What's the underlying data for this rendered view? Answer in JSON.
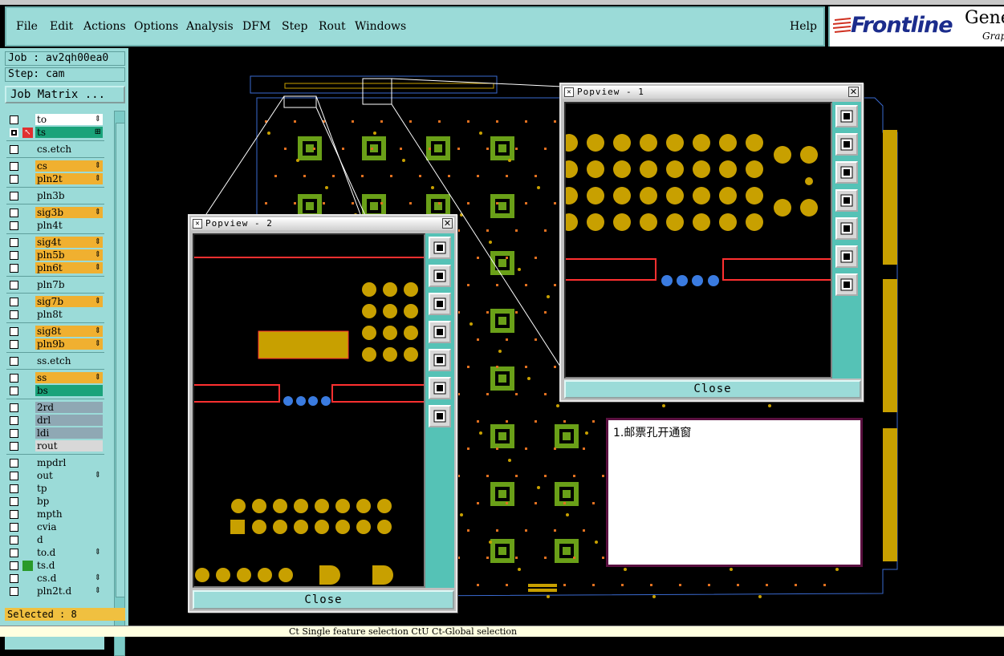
{
  "menu": {
    "items": [
      "File",
      "Edit",
      "Actions",
      "Options",
      "Analysis",
      "DFM",
      "Step",
      "Rout",
      "Windows"
    ],
    "help": "Help"
  },
  "brand": {
    "name": "Frontline",
    "sub1": "Gene",
    "sub2": "Grap"
  },
  "job": {
    "job_label": "Job : av2qh00ea0",
    "step_label": "Step: cam",
    "matrix_button": "Job Matrix ..."
  },
  "layers": [
    {
      "name": "to",
      "color": "#ffffff",
      "mark": "⇕"
    },
    {
      "name": "ts",
      "color": "#1aa37a",
      "mark": "⊞"
    },
    {
      "name": "cs.etch",
      "color": "#9bdbd8",
      "mark": ""
    },
    {
      "name": "cs",
      "color": "#f0b030",
      "mark": "⇕"
    },
    {
      "name": "pln2t",
      "color": "#f0b030",
      "mark": "⇕"
    },
    {
      "name": "pln3b",
      "color": "#9bdbd8",
      "mark": ""
    },
    {
      "name": "sig3b",
      "color": "#f0b030",
      "mark": "⇕"
    },
    {
      "name": "pln4t",
      "color": "#9bdbd8",
      "mark": ""
    },
    {
      "name": "sig4t",
      "color": "#f0b030",
      "mark": "⇕"
    },
    {
      "name": "pln5b",
      "color": "#f0b030",
      "mark": "⇕"
    },
    {
      "name": "pln6t",
      "color": "#f0b030",
      "mark": "⇕"
    },
    {
      "name": "pln7b",
      "color": "#9bdbd8",
      "mark": ""
    },
    {
      "name": "sig7b",
      "color": "#f0b030",
      "mark": "⇕"
    },
    {
      "name": "pln8t",
      "color": "#9bdbd8",
      "mark": ""
    },
    {
      "name": "sig8t",
      "color": "#f0b030",
      "mark": "⇕"
    },
    {
      "name": "pln9b",
      "color": "#f0b030",
      "mark": "⇕"
    },
    {
      "name": "ss.etch",
      "color": "#9bdbd8",
      "mark": ""
    },
    {
      "name": "ss",
      "color": "#f0b030",
      "mark": "⇕"
    },
    {
      "name": "bs",
      "color": "#1aa37a",
      "mark": ""
    },
    {
      "name": "2rd",
      "color": "#8fa8b4",
      "mark": ""
    },
    {
      "name": "drl",
      "color": "#8fa8b4",
      "mark": ""
    },
    {
      "name": "ldi",
      "color": "#8fa8b4",
      "mark": ""
    },
    {
      "name": "rout",
      "color": "#d8d8d8",
      "mark": ""
    },
    {
      "name": "mpdrl",
      "color": "#9bdbd8",
      "mark": ""
    },
    {
      "name": "out",
      "color": "#9bdbd8",
      "mark": "⇕"
    },
    {
      "name": "tp",
      "color": "#9bdbd8",
      "mark": ""
    },
    {
      "name": "bp",
      "color": "#9bdbd8",
      "mark": ""
    },
    {
      "name": "mpth",
      "color": "#9bdbd8",
      "mark": ""
    },
    {
      "name": "cvia",
      "color": "#9bdbd8",
      "mark": ""
    },
    {
      "name": "d",
      "color": "#9bdbd8",
      "mark": ""
    },
    {
      "name": "to.d",
      "color": "#9bdbd8",
      "mark": "⇕"
    },
    {
      "name": "ts.d",
      "color": "#9bdbd8",
      "mark": ""
    },
    {
      "name": "cs.d",
      "color": "#9bdbd8",
      "mark": "⇕"
    },
    {
      "name": "pln2t.d",
      "color": "#9bdbd8",
      "mark": "⇕"
    }
  ],
  "selected": "Selected : 8",
  "popview1": {
    "title": "Popview - 1",
    "close_label": "Close"
  },
  "popview2": {
    "title": "Popview - 2",
    "close_label": "Close"
  },
  "note": {
    "text": "1.邮票孔开通窗"
  },
  "status": {
    "text": "Ct  Single feature selection  CtU  Ct-Global selection"
  },
  "colors": {
    "panel": "#9bdbd8",
    "pad": "#c8a000",
    "via": "#3a7be0",
    "outline": "#ff3030"
  }
}
